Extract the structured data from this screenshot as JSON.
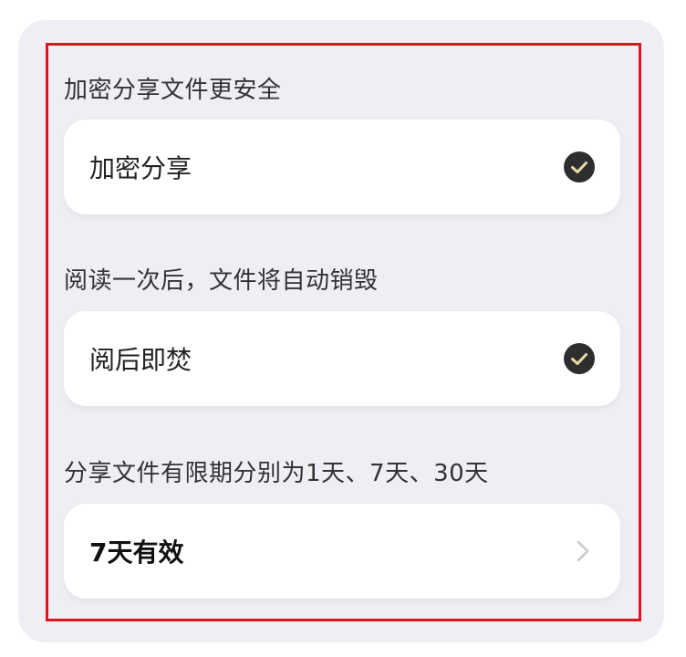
{
  "sections": [
    {
      "caption": "加密分享文件更安全",
      "option_label": "加密分享",
      "control": "check-icon",
      "checked": true
    },
    {
      "caption": "阅读一次后，文件将自动销毁",
      "option_label": "阅后即焚",
      "control": "check-icon",
      "checked": true
    },
    {
      "caption": "分享文件有限期分别为1天、7天、30天",
      "option_label": "7天有效",
      "control": "chevron-right-icon"
    }
  ],
  "colors": {
    "panel_background": "#efeef4",
    "card_background": "#ffffff",
    "check_fill": "#2e2e2e",
    "check_mark": "#e9d9a6",
    "highlight_border": "#e0141e",
    "chevron": "#c8c8c8"
  }
}
